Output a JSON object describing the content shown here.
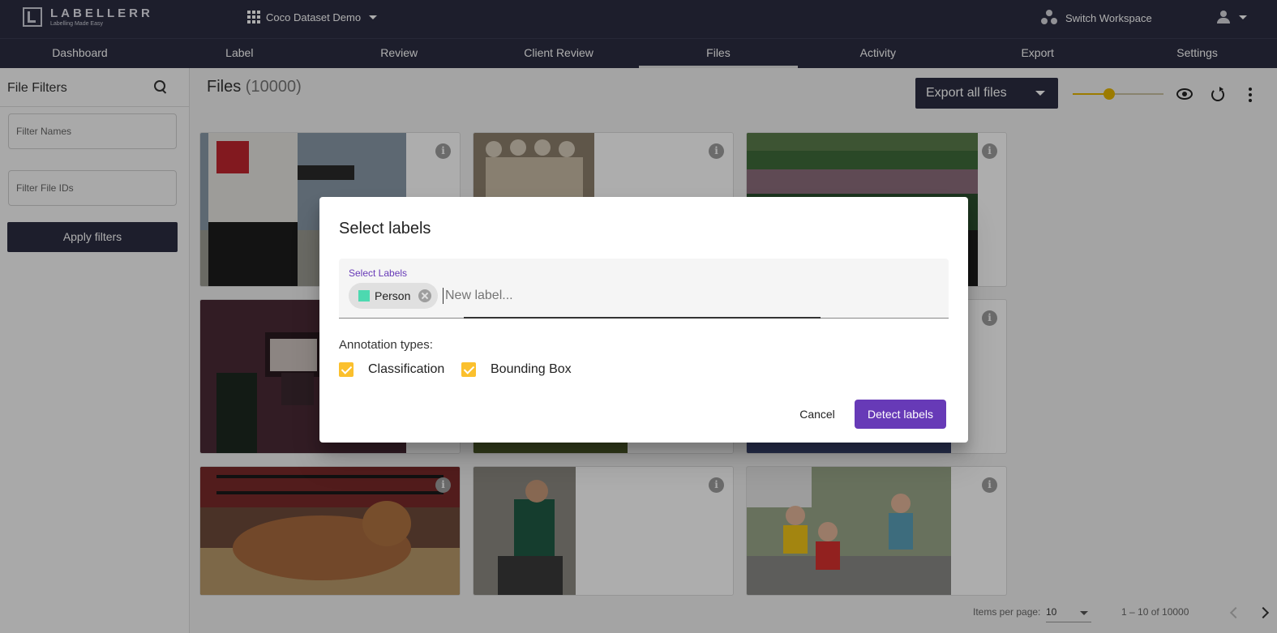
{
  "header": {
    "logo_name": "LABELLERR",
    "logo_tagline": "Labelling Made Easy",
    "project_name": "Coco Dataset Demo",
    "switch_workspace": "Switch Workspace"
  },
  "nav": {
    "items": [
      {
        "label": "Dashboard"
      },
      {
        "label": "Label"
      },
      {
        "label": "Review"
      },
      {
        "label": "Client Review"
      },
      {
        "label": "Files"
      },
      {
        "label": "Activity"
      },
      {
        "label": "Export"
      },
      {
        "label": "Settings"
      }
    ],
    "active": "Files"
  },
  "sidebar": {
    "title": "File Filters",
    "filter_names_placeholder": "Filter Names",
    "filter_ids_placeholder": "Filter File IDs",
    "apply_label": "Apply filters"
  },
  "main": {
    "title": "Files",
    "count": "(10000)",
    "export_label": "Export all files",
    "zoom_slider_value": 0.4,
    "info_glyph": "i"
  },
  "pagination": {
    "items_per_page_label": "Items per page:",
    "items_per_page": "10",
    "range": "1 – 10 of 10000"
  },
  "dialog": {
    "title": "Select labels",
    "field_label": "Select Labels",
    "chips": [
      {
        "label": "Person",
        "color": "#4dd9b0"
      }
    ],
    "input_placeholder": "New label...",
    "annotation_types_label": "Annotation types:",
    "annotation_types": [
      {
        "label": "Classification",
        "checked": true
      },
      {
        "label": "Bounding Box",
        "checked": true
      }
    ],
    "cancel_label": "Cancel",
    "confirm_label": "Detect labels"
  },
  "colors": {
    "nav_bg": "#2b2d42",
    "accent_purple": "#673ab7",
    "accent_yellow": "#fbc02d"
  }
}
